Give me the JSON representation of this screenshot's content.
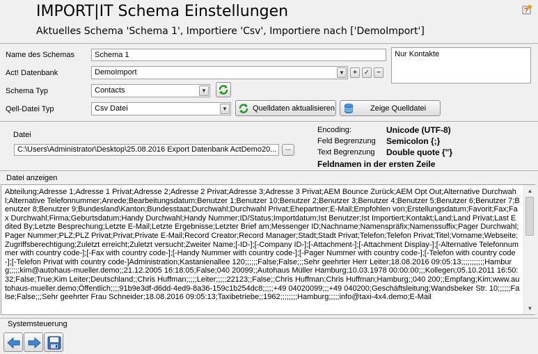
{
  "header": {
    "title": "IMPORT|IT Schema Einstellungen",
    "subtitle": "Aktuelles Schema 'Schema 1', Importiere 'Csv', Importiere nach ['DemoImport']"
  },
  "form": {
    "schema_name_label": "Name des Schemas",
    "schema_name_value": "Schema 1",
    "act_db_label": "Act! Datenbank",
    "act_db_value": "DemoImport",
    "schema_type_label": "Schema Typ",
    "schema_type_value": "Contacts",
    "source_type_label": "Qell-Datei Typ",
    "source_type_value": "Csv Datei",
    "notes_value": "Nur Kontakte",
    "refresh_button": "Quelldaten aktualisieren",
    "show_source_button": "Zeige Quelldatei"
  },
  "file": {
    "label": "Datei",
    "path": "C:\\Users\\Administrator\\Desktop\\25.08.2016 Export Datenbank ActDemo20...",
    "browse": "..."
  },
  "encoding": {
    "encoding_label": "Encoding:",
    "encoding_value": "Unicode (UTF-8)",
    "field_sep_label": "Feld Begrenzung",
    "field_sep_value": "Semicolon {;}",
    "text_sep_label": "Text Begrenzung",
    "text_sep_value": "Double quote {\"}",
    "header_row": "Feldnamen in der ersten Zeile"
  },
  "preview": {
    "label": "Datei anzeigen",
    "content": "Abteilung;Adresse 1;Adresse 1 Privat;Adresse 2;Adresse 2 Privat;Adresse 3;Adresse 3 Privat;AEM Bounce Zurück;AEM Opt Out;Alternative Durchwahl;Alternative Telefonnummer;Anrede;Bearbeitungsdatum;Benutzer 1;Benutzer 10;Benutzer 2;Benutzer 3;Benutzer 4;Benutzer 5;Benutzer 6;Benutzer 7;Benutzer 8;Benutzer 9;Bundesland\\Kanton;Bundesstaat;Durchwahl;Durchwahl Privat;Ehepartner;E-Mail;Empfohlen von;Erstellungsdatum;Favorit;Fax;Fax Durchwahl;Firma;Geburtsdatum;Handy Durchwahl;Handy Nummer;ID/Status;Importdatum;Ist Benutzer;Ist Importiert;Kontakt;Land;Land Privat;Last Edited By;Letzte Besprechung;Letzte E-Mail;Letzte Ergebnisse;Letzter Brief am;Messenger ID;Nachname;Namenspräfix;Namenssuffix;Pager Durchwahl;Pager Nummer;PLZ;PLZ Privat;Privat;Private E-Mail;Record Creator;Record Manager;Stadt;Stadt Privat;Telefon;Telefon Privat;Titel;Vorname;Webseite;Zugriffsberechtigung;Zuletzt erreicht;Zuletzt versucht;Zweiter Name;[-ID-];[-Company ID-];[-Attachment-];[-Attachment Display-];[-Alternative Telefonnummer with country code-];[-Fax with country code-];[-Handy Nummer with country code-];[-Pager Nummer with country code-];[-Telefon with country code-];[-Telefon Privat with country code-]Administration;Kastanienallee 120;;;;;;False;False;;;Sehr geehrter Herr Leiter;18.08.2016 09:05:13;;;;;;;;;;;Hamburg;;;;;kim@autohaus-mueller.demo;;21.12.2005 16:18:05;False;040 20099;;Autohaus Müller Hamburg;10.03.1978 00:00:00;;;Kollegen;05.10.2011 16:50:32;False;True;Kim Leiter;Deutschland;;Chris Huffman;;;;;Leiter;;;;;22123;;False;;Chris Huffman;Chris Huffman;Hamburg;;040 200;;Empfang;Kim;www.autohaus-mueller.demo;Öffentlich;;;;91b9e3df-d6dd-4ed9-8a36-159c1b254dc8;;;;;+49 04020099;;;+49 040200;Geschäftsleitung;Wandsbeker Str. 10;;;;;;False;False;;;Sehr geehrter Frau Schneider;18.08.2016 09:05:13;Taxibetriebe;;1962;;;;;;;;Hamburg;;;;;info@taxi-4x4.demo;E-Mail"
  },
  "footer": {
    "label": "Systemsteuerung"
  }
}
